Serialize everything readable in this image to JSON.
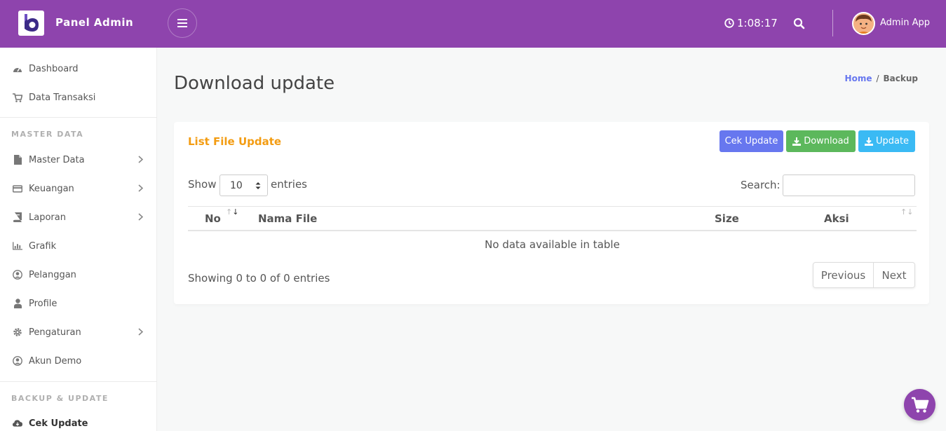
{
  "header": {
    "brand": "Panel Admin",
    "clock": "1:08:17",
    "user": "Admin App"
  },
  "sidebar": {
    "items_top": [
      {
        "label": "Dashboard",
        "icon": "dashboard-icon"
      },
      {
        "label": "Data Transaksi",
        "icon": "cart-icon"
      }
    ],
    "section_master": "MASTER DATA",
    "items_master": [
      {
        "label": "Master Data",
        "icon": "file-icon",
        "has_children": true
      },
      {
        "label": "Keuangan",
        "icon": "credit-card-icon",
        "has_children": true
      },
      {
        "label": "Laporan",
        "icon": "book-icon",
        "has_children": true
      },
      {
        "label": "Grafik",
        "icon": "bar-chart-icon",
        "has_children": false
      },
      {
        "label": "Pelanggan",
        "icon": "user-circle-icon",
        "has_children": false
      },
      {
        "label": "Profile",
        "icon": "user-icon",
        "has_children": false
      },
      {
        "label": "Pengaturan",
        "icon": "gear-icon",
        "has_children": true
      },
      {
        "label": "Akun Demo",
        "icon": "user-circle-icon",
        "has_children": false
      }
    ],
    "section_backup": "BACKUP & UPDATE",
    "active_item": {
      "label": "Cek Update",
      "icon": "cloud-download-icon"
    }
  },
  "page": {
    "title": "Download update",
    "breadcrumb": {
      "home": "Home",
      "sep": "/",
      "current": "Backup"
    }
  },
  "card": {
    "title": "List File Update",
    "buttons": {
      "cek": "Cek Update",
      "download": "Download",
      "update": "Update"
    },
    "show_label": "Show",
    "page_length": "10",
    "entries_label": "entries",
    "search_label": "Search:",
    "search_value": "",
    "columns": [
      "No",
      "Nama File",
      "Size",
      "Aksi"
    ],
    "empty_text": "No data available in table",
    "info": "Showing 0 to 0 of 0 entries",
    "pager": {
      "prev": "Previous",
      "next": "Next"
    }
  },
  "colors": {
    "header_bg": "#8e44ad",
    "primary": "#6777ef",
    "success": "#5cb85c",
    "info": "#3abaf4",
    "card_title": "#f39c12"
  }
}
